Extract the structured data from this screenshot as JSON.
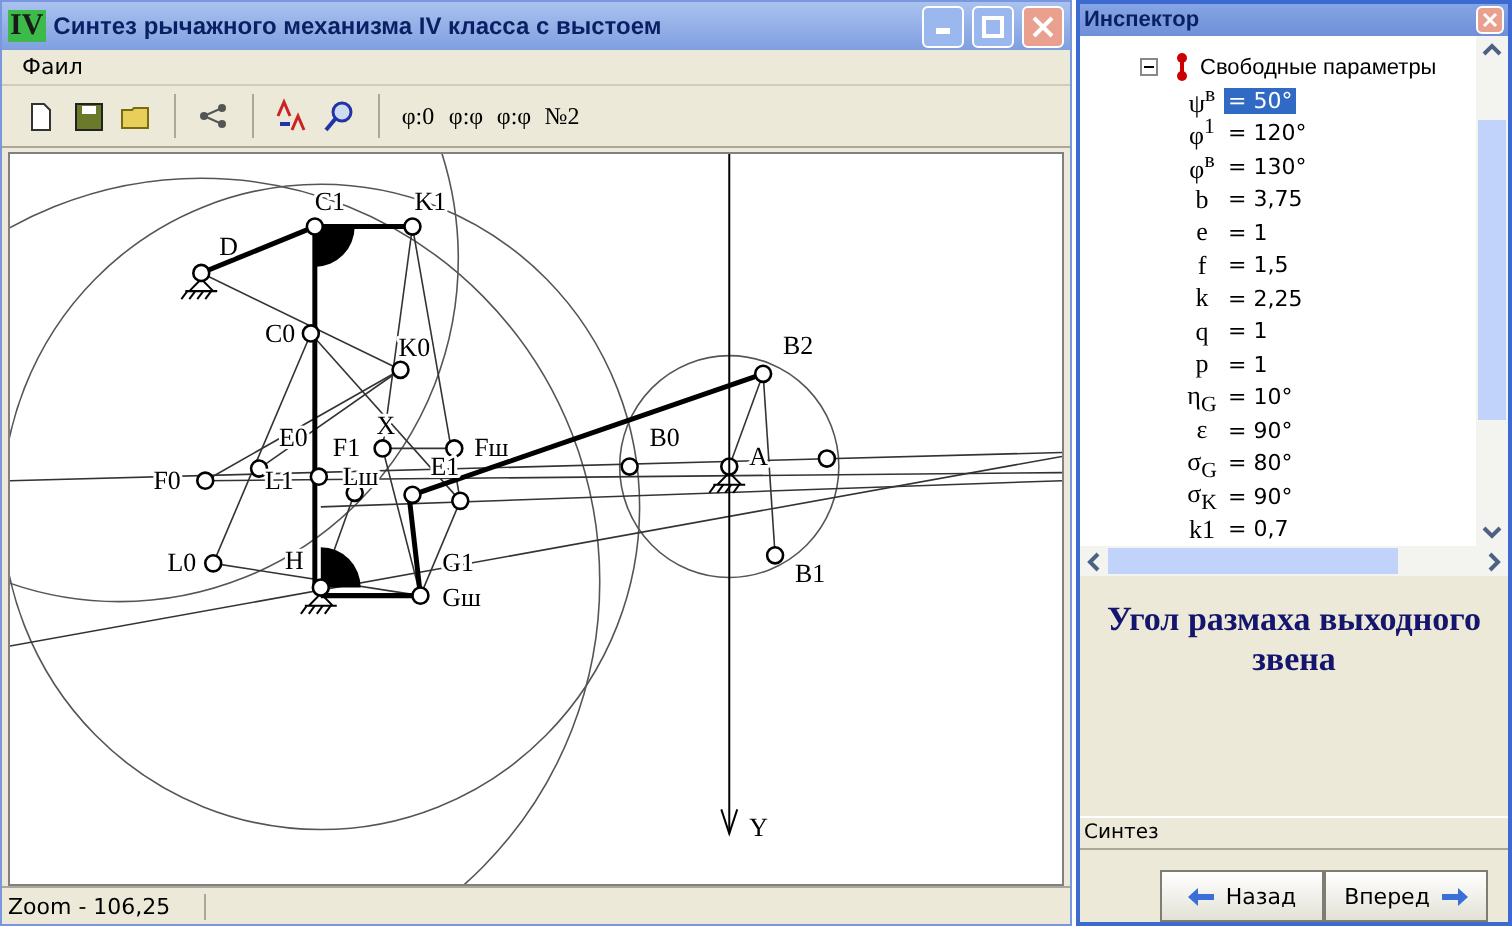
{
  "window": {
    "logo": "IV",
    "title": "Синтез рычажного механизма IV класса с выстоем"
  },
  "menu": [
    "Фаил"
  ],
  "toolbar": {
    "text_buttons": [
      "φ:0",
      "φ:φ",
      "φ:φ",
      "№2"
    ]
  },
  "diagram": {
    "labels": [
      "C1",
      "K1",
      "D",
      "C0",
      "K0",
      "E0",
      "X",
      "F1",
      "Fш",
      "F0",
      "L1",
      "Lш",
      "E1",
      "H",
      "G1",
      "Gш",
      "L0",
      "B2",
      "B0",
      "A",
      "B1"
    ],
    "axis_label": "Y"
  },
  "status_bar": {
    "zoom": "Zoom - 106,25"
  },
  "inspector": {
    "title": "Инспектор",
    "group": {
      "label": "Свободные параметры",
      "expanded": true,
      "children": [
        {
          "symbol": "ψ$^{в}$",
          "value": "= 50°",
          "selected": true
        },
        {
          "symbol": "φ$^{1}$",
          "value": "= 120°",
          "selected": false
        },
        {
          "symbol": "φ$^{в}$",
          "value": "= 130°",
          "selected": false
        },
        {
          "symbol": "b",
          "value": "= 3,75",
          "selected": false
        },
        {
          "symbol": "e",
          "value": "= 1",
          "selected": false
        },
        {
          "symbol": "f",
          "value": "= 1,5",
          "selected": false
        },
        {
          "symbol": "k",
          "value": "= 2,25",
          "selected": false
        },
        {
          "symbol": "q",
          "value": "= 1",
          "selected": false
        },
        {
          "symbol": "p",
          "value": "= 1",
          "selected": false
        },
        {
          "symbol": "η$_{G}$",
          "value": "= 10°",
          "selected": false
        },
        {
          "symbol": "ε",
          "value": "= 90°",
          "selected": false
        },
        {
          "symbol": "σ$_{G}$",
          "value": "= 80°",
          "selected": false
        },
        {
          "symbol": "σ$_{K}$",
          "value": "= 90°",
          "selected": false
        },
        {
          "symbol": "k1",
          "value": "= 0,7",
          "selected": false
        }
      ]
    },
    "description": "Угол размаха выходного звена",
    "section": "Синтез",
    "buttons": [
      {
        "label": "Назад",
        "kind": "back"
      },
      {
        "label": "Вперед",
        "kind": "forward"
      }
    ]
  }
}
